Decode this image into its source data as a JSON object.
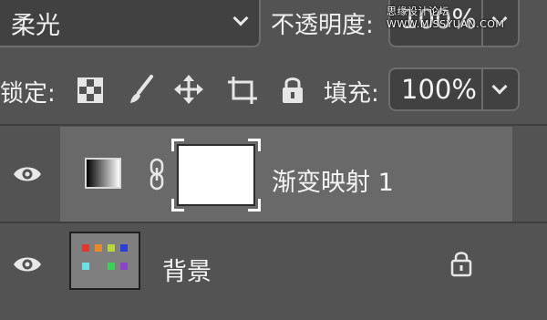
{
  "top": {
    "blend_mode": "柔光",
    "opacity_label": "不透明度:",
    "opacity_value": "100%",
    "watermark": "思缘设计论坛 WWW.MISSYUAN.COM"
  },
  "lock_bar": {
    "label": "锁定:",
    "icons": [
      "lock-transparent-pixels-icon",
      "lock-image-pixels-brush-icon",
      "lock-position-move-icon",
      "lock-artboard-icon",
      "lock-all-padlock-icon"
    ],
    "fill_label": "填充:",
    "fill_value": "100%"
  },
  "layers": [
    {
      "name": "渐变映射 1",
      "visible": true,
      "selected": true,
      "thumbnail": "gradient-map-adjustment",
      "mask": "white-mask-selected"
    },
    {
      "name": "背景",
      "visible": true,
      "selected": false,
      "locked": true,
      "thumbnail_swatches": [
        "#e03a2f",
        "#e88a2a",
        "#b9d63a",
        "#2a3fd6",
        "#6fe0e6",
        "#3ccf5a",
        "#8a44c8"
      ]
    }
  ],
  "colors": {
    "panel_bg": "#535353",
    "field_bg": "#414141",
    "selected_row": "#696969",
    "text": "#f0f0f0"
  }
}
